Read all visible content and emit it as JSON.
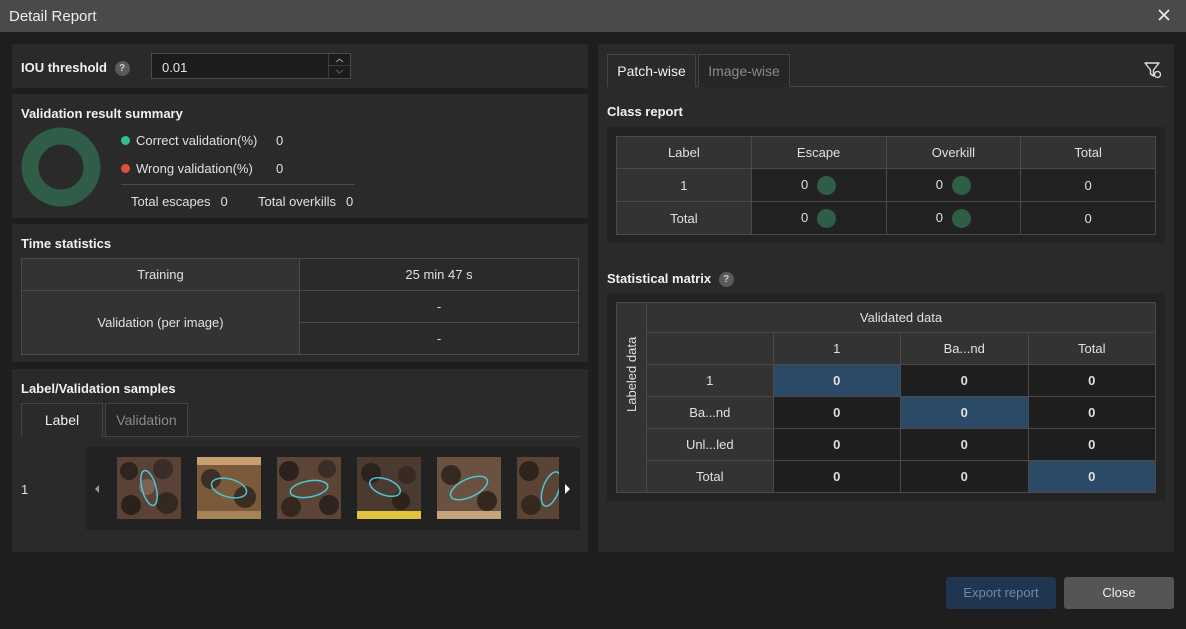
{
  "window": {
    "title": "Detail Report"
  },
  "iou": {
    "label": "IOU threshold",
    "help": "?",
    "value": "0.01"
  },
  "summary": {
    "title": "Validation result summary",
    "correct_label": "Correct validation(%)",
    "correct_value": "0",
    "wrong_label": "Wrong validation(%)",
    "wrong_value": "0",
    "escapes_label": "Total escapes",
    "escapes_value": "0",
    "overkills_label": "Total overkills",
    "overkills_value": "0",
    "colors": {
      "correct": "#2fbf8f",
      "wrong": "#d9533a",
      "ring": "#2f5d47"
    }
  },
  "time": {
    "title": "Time statistics",
    "training_label": "Training",
    "training_value": "25 min 47 s",
    "validation_label": "Validation (per image)",
    "validation_value1": "-",
    "validation_value2": "-"
  },
  "samples": {
    "title": "Label/Validation samples",
    "tabs": [
      "Label",
      "Validation"
    ],
    "row_label": "1"
  },
  "right": {
    "tabs": [
      "Patch-wise",
      "Image-wise"
    ],
    "class_report": {
      "title": "Class report",
      "headers": [
        "Label",
        "Escape",
        "Overkill",
        "Total"
      ],
      "rows": [
        {
          "label": "1",
          "escape": "0",
          "overkill": "0",
          "total": "0"
        },
        {
          "label": "Total",
          "escape": "0",
          "overkill": "0",
          "total": "0"
        }
      ]
    },
    "matrix": {
      "title": "Statistical matrix",
      "help": "?",
      "validated_header": "Validated data",
      "labeled_header": "Labeled data",
      "col_headers": [
        "1",
        "Ba...nd",
        "Total"
      ],
      "rows": [
        {
          "label": "1",
          "values": [
            "0",
            "0",
            "0"
          ]
        },
        {
          "label": "Ba...nd",
          "values": [
            "0",
            "0",
            "0"
          ]
        },
        {
          "label": "Unl...led",
          "values": [
            "0",
            "0",
            "0"
          ]
        },
        {
          "label": "Total",
          "values": [
            "0",
            "0",
            "0"
          ]
        }
      ],
      "highlight_color": "#2b4a66"
    }
  },
  "buttons": {
    "export": "Export report",
    "close": "Close"
  }
}
